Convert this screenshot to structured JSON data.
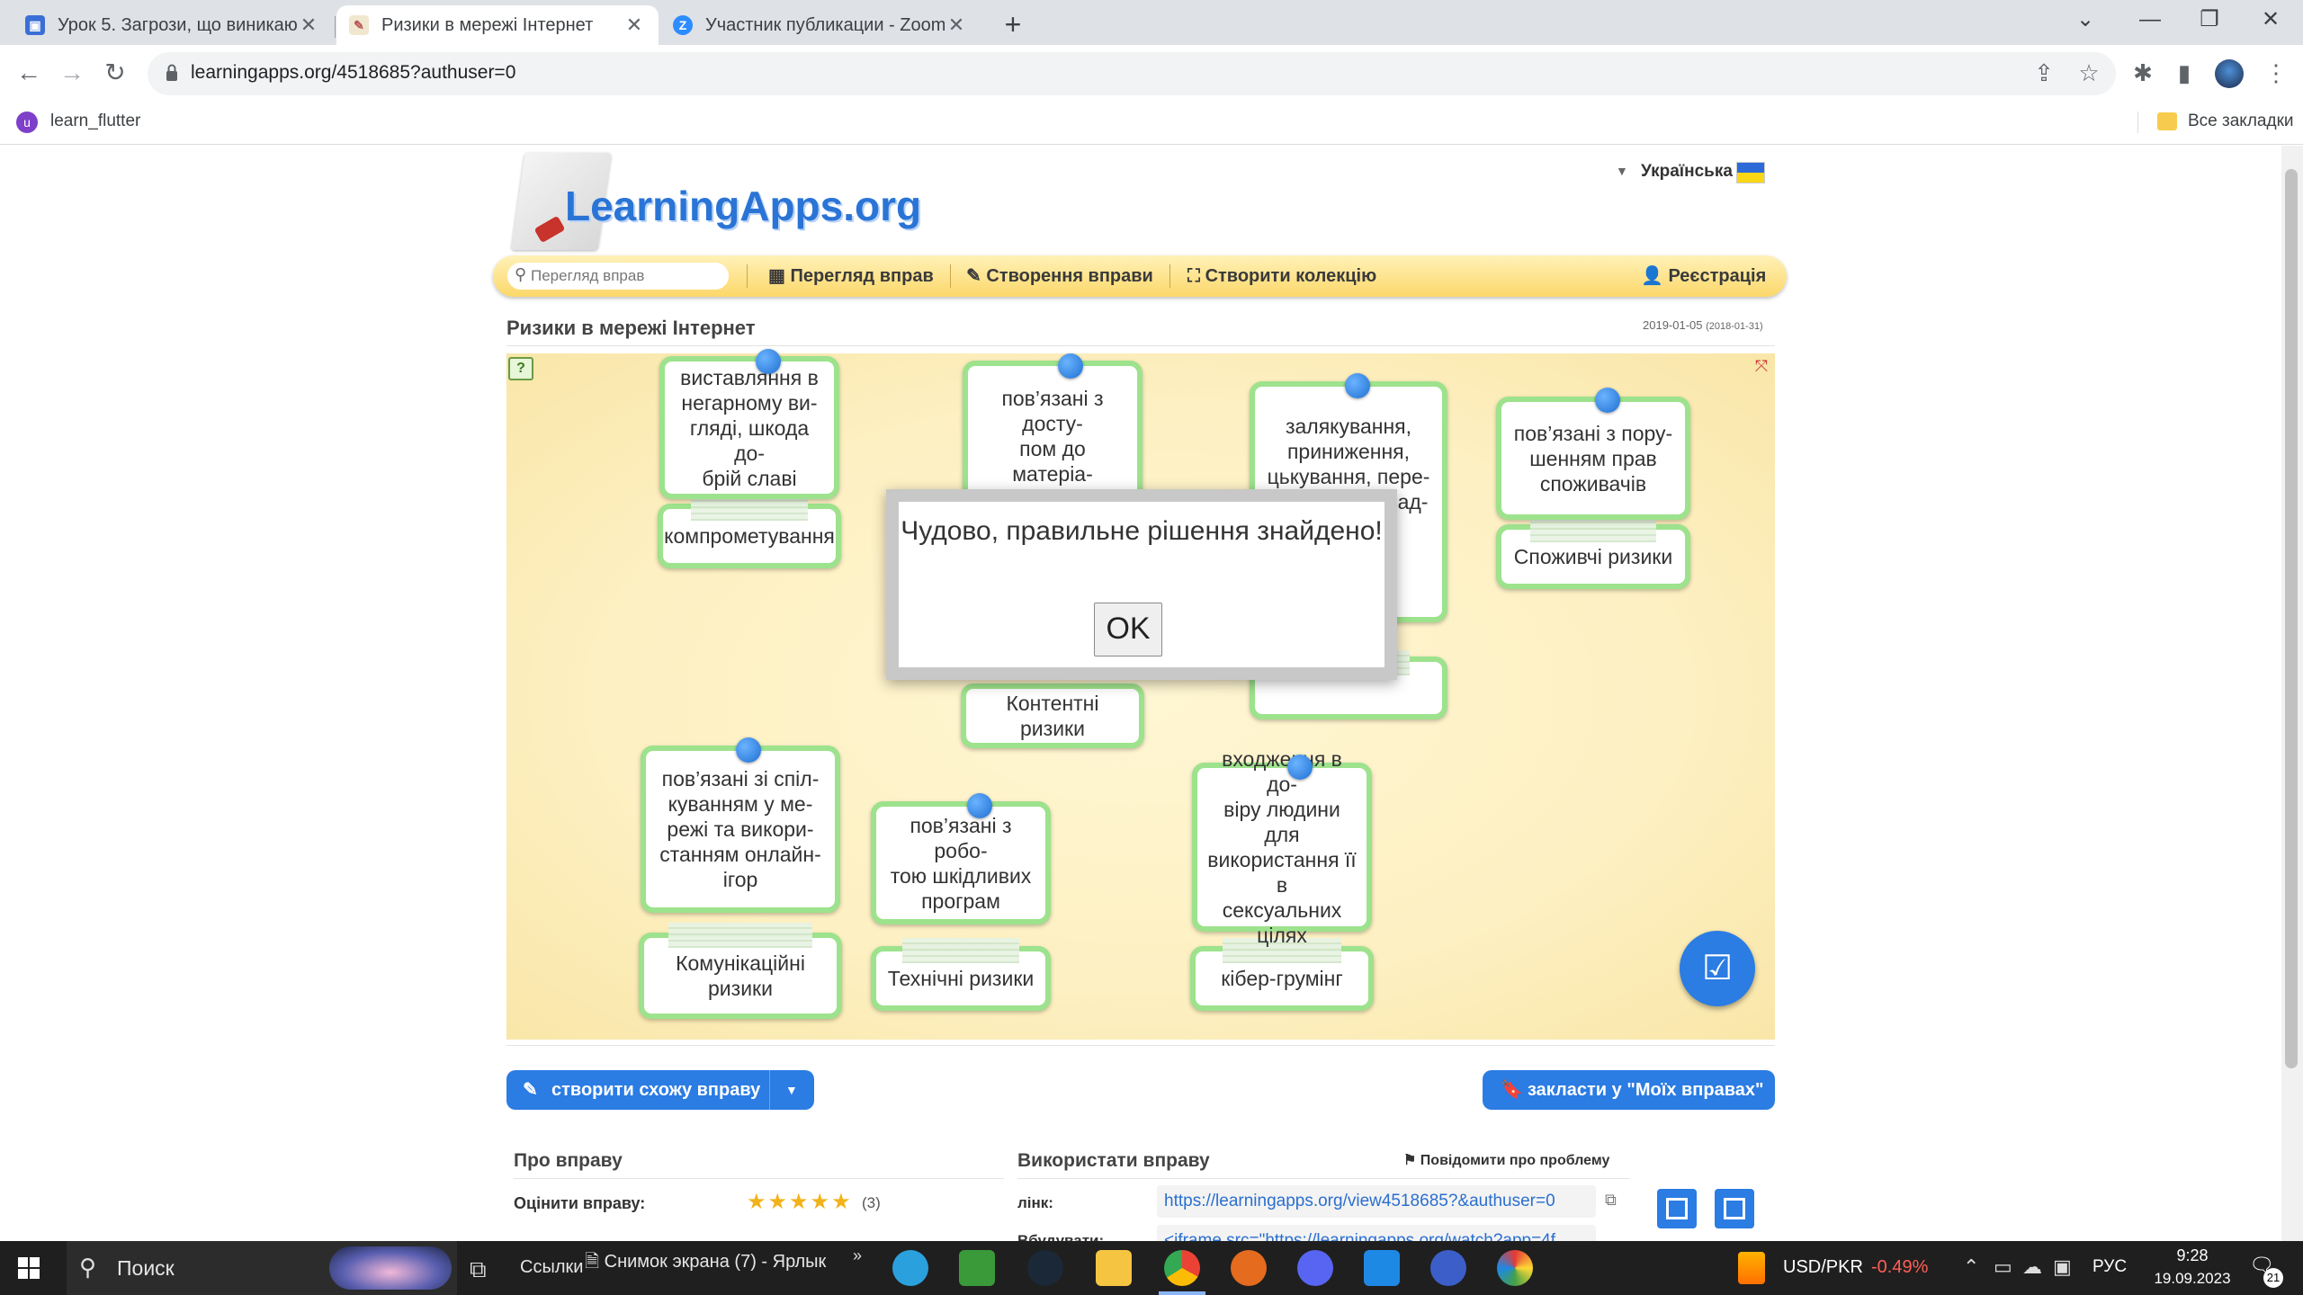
{
  "browser": {
    "tabs": [
      {
        "title": "Урок 5. Загрози, що виникають",
        "active": false
      },
      {
        "title": "Ризики в мережі Інтернет",
        "active": true
      },
      {
        "title": "Участник публикации - Zoom",
        "active": false
      }
    ],
    "new_tab": "+",
    "url": "learningapps.org/4518685?authuser=0",
    "bookmarks": {
      "learn_flutter": "learn_flutter",
      "all": "Все закладки"
    }
  },
  "site": {
    "logo": "LearningApps.org",
    "language": "Українська",
    "search_placeholder": "Перегляд вправ",
    "nav": {
      "browse": "Перегляд вправ",
      "create": "Створення вправи",
      "collection": "Створити колекцію",
      "register": "Реєстрація"
    }
  },
  "app": {
    "title": "Ризики в мережі Інтернет",
    "date": "2019-01-05",
    "date_orig": "(2018-01-31)",
    "cards": [
      {
        "desc": "виставляння в\nнегарному ви-\nгляді, шкода до-\nбрій славі",
        "label": "компрометування"
      },
      {
        "desc": "пов’язані з досту-\nпом до матеріа-\nлів, розміщених у\nмережі, матеріа-",
        "label": "Контентні ризики"
      },
      {
        "desc": "залякування,\nприниження,\nцькування, пере-\nслідування, над-\n...ідом-\n...иста-\n...их",
        "label": ""
      },
      {
        "desc": "пов’язані з пору-\nшенням прав\nспоживачів",
        "label": "Споживчі ризики"
      },
      {
        "desc": "пов’язані зі спіл-\nкуванням у ме-\nрежі та викори-\nстанням онлайн-\nігор",
        "label": "Комунікаційні\nризики"
      },
      {
        "desc": "пов’язані з робо-\nтою шкідливих\nпрограм",
        "label": "Технічні ризики"
      },
      {
        "desc": "входження в до-\nвіру людини для\nвикористання її в\nсексуальних\nцілях",
        "label": "кібер-грумінг"
      }
    ],
    "dialog": {
      "message": "Чудово, правильне рішення знайдено!",
      "ok": "OK"
    },
    "buttons": {
      "create_similar": "створити схожу вправу",
      "bookmark": "закласти у \"Моїх вправах\""
    }
  },
  "info": {
    "about_title": "Про вправу",
    "rate_label": "Оцінити вправу:",
    "rating": 5,
    "rating_count": "(3)",
    "use_title": "Використати вправу",
    "report": "Повідомити про проблему",
    "link_label": "лінк:",
    "link_value": "https://learningapps.org/view4518685?&authuser=0",
    "embed_label": "Вбудувати:",
    "embed_value": "<iframe src=\"https://learningapps.org/watch?app=4f..."
  },
  "taskbar": {
    "search": "Поиск",
    "links": "Ссылки",
    "window": "Снимок экрана (7) - Ярлык",
    "currency": "USD/PKR",
    "change": "-0.49%",
    "lang": "РУС",
    "time": "9:28",
    "date": "19.09.2023",
    "notif": "21"
  },
  "colors": {
    "accent": "#2b7ce3",
    "card_border": "#9de28c",
    "negative": "#ff5f57"
  }
}
